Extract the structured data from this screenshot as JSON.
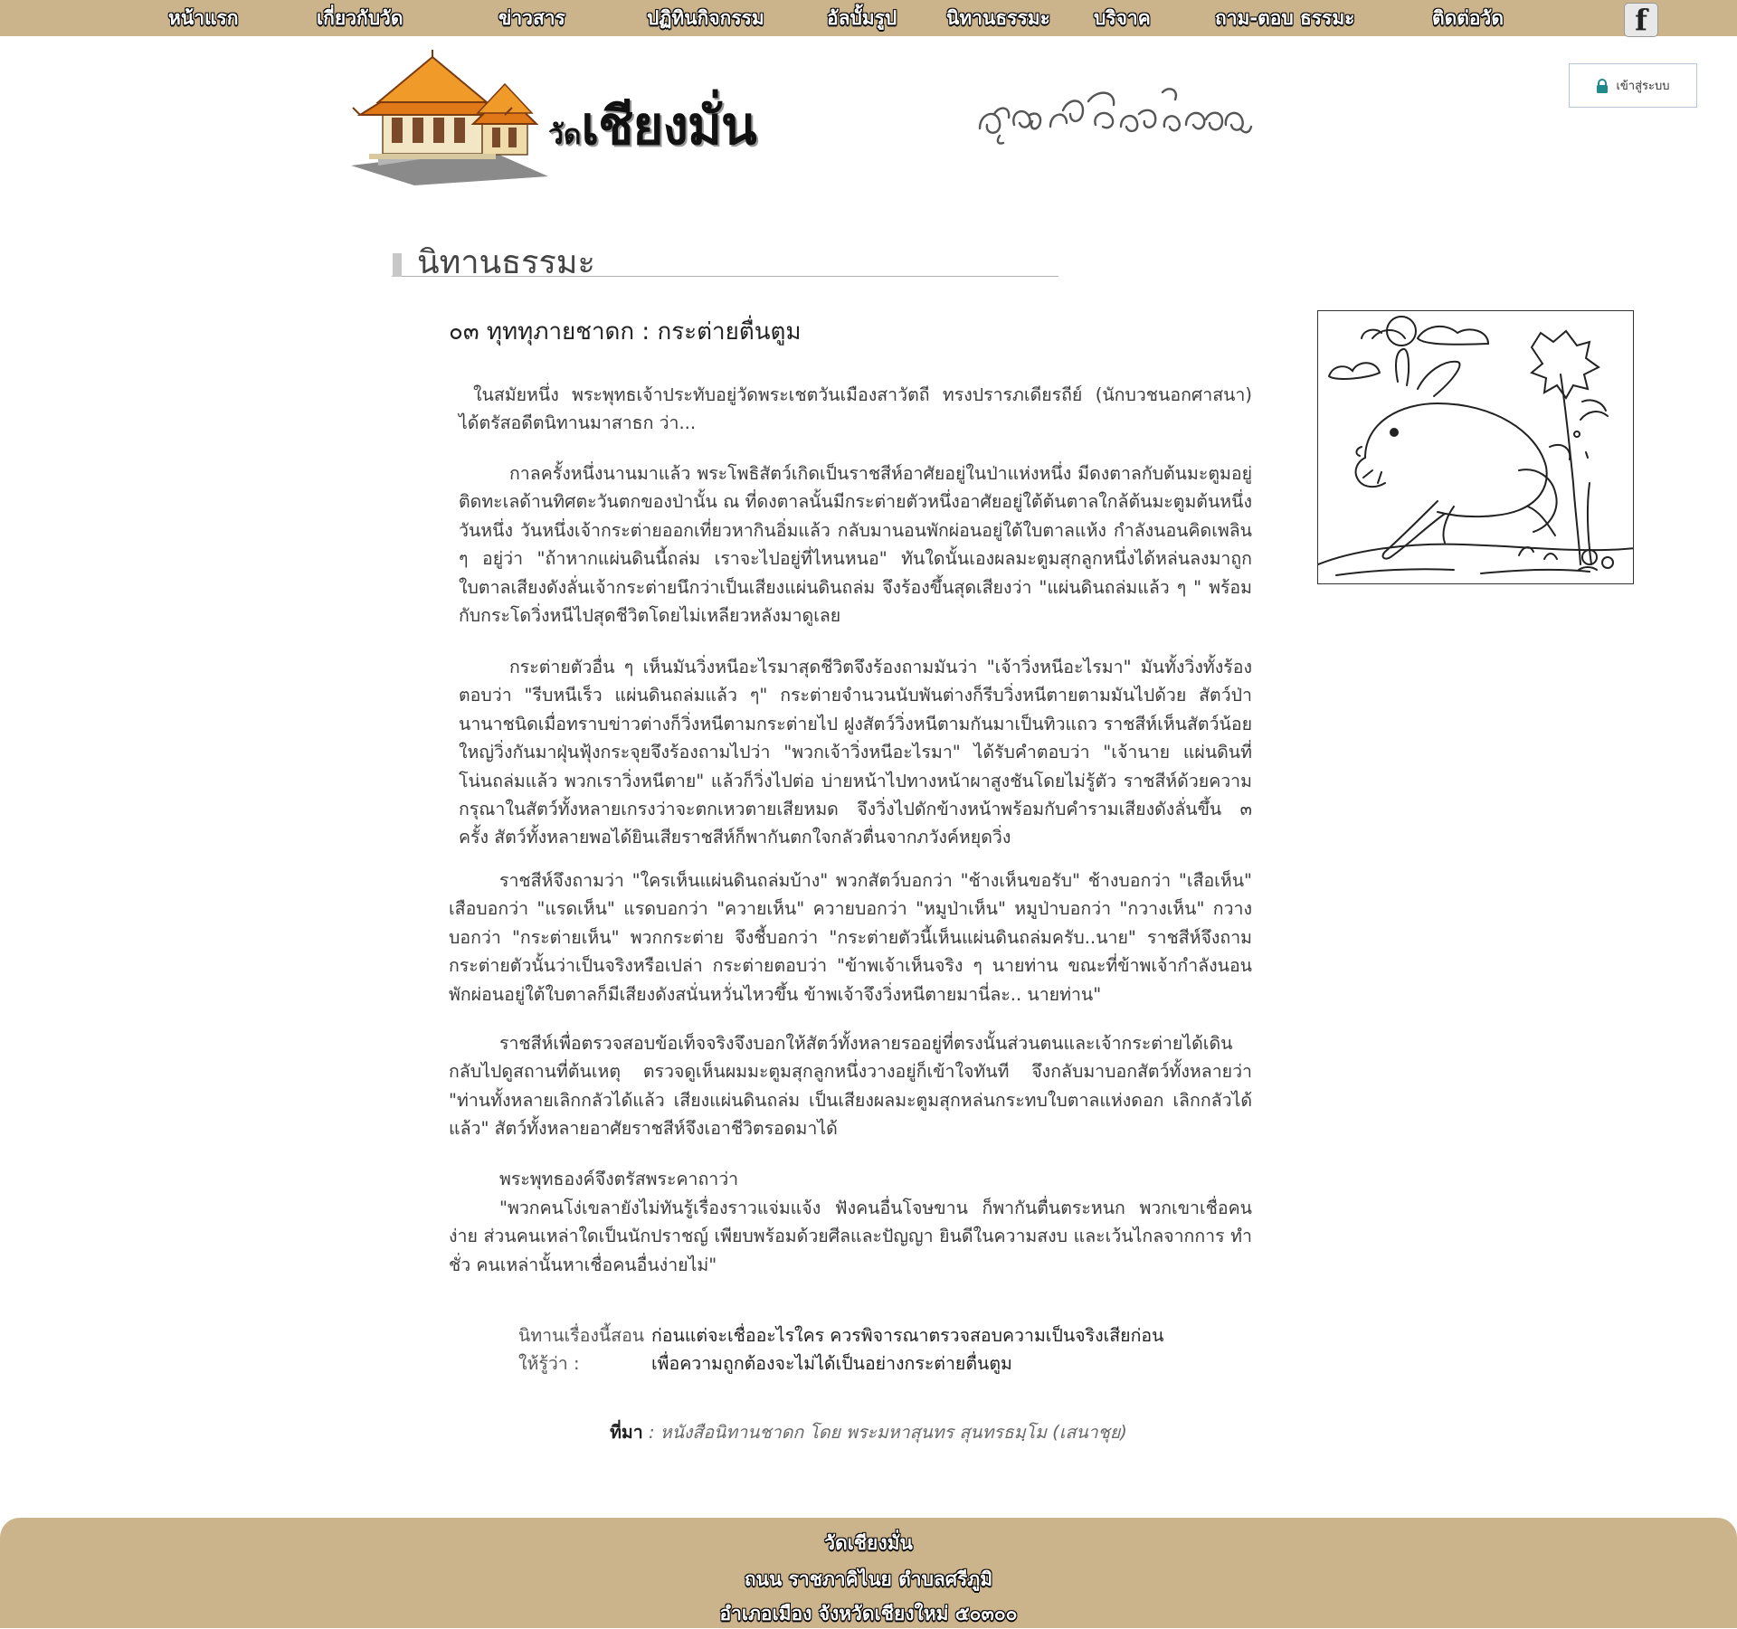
{
  "nav": {
    "items": [
      {
        "label": "หน้าแรก"
      },
      {
        "label": "เกี่ยวกับวัด"
      },
      {
        "label": "ข่าวสาร"
      },
      {
        "label": "ปฏิทินกิจกรรม"
      },
      {
        "label": "อัลบั้มรูป"
      },
      {
        "label": "นิทานธรรมะ"
      },
      {
        "label": "บริจาค"
      },
      {
        "label": "ถาม-ตอบ ธรรมะ"
      },
      {
        "label": "ติดต่อวัด"
      }
    ],
    "facebook_glyph": "f"
  },
  "header": {
    "name_prefix": "วัด",
    "name_main": "เชียงมั่น",
    "login_label": "เข้าสู่ระบบ"
  },
  "section": {
    "title": "นิทานธรรมะ"
  },
  "article": {
    "title": "๐๓ ทุททุภายชาดก : กระต่ายตื่นตูม",
    "paragraphs": [
      "ในสมัยหนึ่ง พระพุทธเจ้าประทับอยู่วัดพระเชตวันเมืองสาวัตถี ทรงปรารภเดียรถีย์ (นักบวชนอกศาสนา) ได้ตรัสอดีตนิทานมาสาธก ว่า...",
      "กาลครั้งหนึ่งนานมาแล้ว พระโพธิสัตว์เกิดเป็นราชสีห์อาศัยอยู่ในป่าแห่งหนึ่ง มีดงตาลกับต้นมะตูมอยู่ติดทะเลด้านทิศตะวันตกของป่านั้น ณ ที่ดงตาลนั้นมีกระต่ายตัวหนึ่งอาศัยอยู่ใต้ต้นตาลใกล้ต้นมะตูมต้นหนึ่ง วันหนึ่ง วันหนึ่งเจ้ากระต่ายออกเที่ยวหากินอิ่มแล้ว กลับมานอนพักผ่อนอยู่ใต้ใบตาลแห้ง กำลังนอนคิดเพลิน ๆ อยู่ว่า \"ถ้าหากแผ่นดินนี้ถล่ม เราจะไปอยู่ที่ไหนหนอ\" ทันใดนั้นเองผลมะตูมสุกลูกหนึ่งได้หล่นลงมาถูกใบตาลเสียงดังลั่นเจ้ากระต่ายนึกว่าเป็นเสียงแผ่นดินถล่ม จึงร้องขึ้นสุดเสียงว่า \"แผ่นดินถล่มแล้ว ๆ \" พร้อมกับกระโดวิ่งหนีไปสุดชีวิตโดยไม่เหลียวหลังมาดูเลย",
      "กระต่ายตัวอื่น ๆ เห็นมันวิ่งหนีอะไรมาสุดชีวิตจึงร้องถามมันว่า \"เจ้าวิ่งหนีอะไรมา\" มันทั้งวิ่งทั้งร้องตอบว่า \"รีบหนีเร็ว แผ่นดินถล่มแล้ว ๆ\" กระต่ายจำนวนนับพันต่างก็รีบวิ่งหนีตายตามมันไปด้วย สัตว์ป่านานาชนิดเมื่อทราบข่าวต่างก็วิ่งหนีตามกระต่ายไป ฝูงสัตว์วิ่งหนีตามกันมาเป็นทิวแถว ราชสีห์เห็นสัตว์น้อยใหญ่วิ่งกันมาฝุ่นฟุ้งกระจุยจึงร้องถามไปว่า \"พวกเจ้าวิ่งหนีอะไรมา\" ได้รับคำตอบว่า \"เจ้านาย แผ่นดินที่โน่นถล่มแล้ว พวกเราวิ่งหนีตาย\" แล้วก็วิ่งไปต่อ บ่ายหน้าไปทางหน้าผาสูงชันโดยไม่รู้ตัว ราชสีห์ด้วยความกรุณาในสัตว์ทั้งหลายเกรงว่าจะตกเหวตายเสียหมด จึงวิ่งไปดักข้างหน้าพร้อมกับคำรามเสียงดังลั่นขึ้น ๓ ครั้ง สัตว์ทั้งหลายพอได้ยินเสียราชสีห์ก็พากันตกใจกลัวตื่นจากภวังค์หยุดวิ่ง",
      "ราชสีห์จึงถามว่า \"ใครเห็นแผ่นดินถล่มบ้าง\" พวกสัตว์บอกว่า \"ช้างเห็นขอรับ\" ช้างบอกว่า \"เสือเห็น\" เสือบอกว่า \"แรดเห็น\" แรดบอกว่า \"ควายเห็น\" ควายบอกว่า \"หมูป่าเห็น\" หมูป่าบอกว่า \"กวางเห็น\" กวางบอกว่า \"กระต่ายเห็น\" พวกกระต่าย จึงชี้บอกว่า \"กระต่ายตัวนี้เห็นแผ่นดินถล่มครับ..นาย\" ราชสีห์จึงถามกระต่ายตัวนั้นว่าเป็นจริงหรือเปล่า กระต่ายตอบว่า \"ข้าพเจ้าเห็นจริง ๆ นายท่าน ขณะที่ข้าพเจ้ากำลังนอนพักผ่อนอยู่ใต้ใบตาลก็มีเสียงดังสนั่นหวั่นไหวขึ้น ข้าพเจ้าจึงวิ่งหนีตายมานี่ละ.. นายท่าน\"",
      "ราชสีห์เพื่อตรวจสอบข้อเท็จจริงจึงบอกให้สัตว์ทั้งหลายรออยู่ที่ตรงนั้นส่วนตนและเจ้ากระต่ายได้เดินกลับไปดูสถานที่ต้นเหตุ ตรวจดูเห็นผมมะตูมสุกลูกหนึ่งวางอยู่ก็เข้าใจทันที จึงกลับมาบอกสัตว์ทั้งหลายว่า \"ท่านทั้งหลายเลิกกลัวได้แล้ว เสียงแผ่นดินถล่ม เป็นเสียงผลมะตูมสุกหล่นกระทบใบตาลแห่งดอก เลิกกลัวได้แล้ว\" สัตว์ทั้งหลายอาศัยราชสีห์จึงเอาชีวิตรอดมาได้",
      "พระพุทธองค์จึงตรัสพระคาถาว่า",
      "\"พวกคนโง่เขลายังไม่ทันรู้เรื่องราวแจ่มแจ้ง ฟังคนอื่นโจษขาน ก็พากันตื่นตระหนก พวกเขาเชื่อคนง่าย ส่วนคนเหล่าใดเป็นนักปราชญ์ เพียบพร้อมด้วยศีลและปัญญา ยินดีในความสงบ และเว้นไกลจากการ ทำชั่ว คนเหล่านั้นหาเชื่อคนอื่นง่ายไม่\""
    ],
    "moral_label": "นิทานเรื่องนี้สอนให้รู้ว่า :",
    "moral_text": "ก่อนแต่จะเชื่ออะไรใคร ควรพิจารณาตรวจสอบความเป็นจริงเสียก่อน เพื่อความถูกต้องจะไม่ได้เป็นอย่างกระต่ายตื่นตูม",
    "source_label": "ที่มา",
    "source_text": ": หนังสือนิทานชาดก โดย พระมหาสุนทร สุนทรธมฺโม (เสนาชุย)"
  },
  "footer": {
    "lines": [
      "วัดเชียงมั่น",
      "ถนน ราชภาคิไนย ตำบลศรีภูมิ",
      "อำเภอเมือง จังหวัดเชียงใหม่ ๕๐๓๐๐"
    ]
  }
}
